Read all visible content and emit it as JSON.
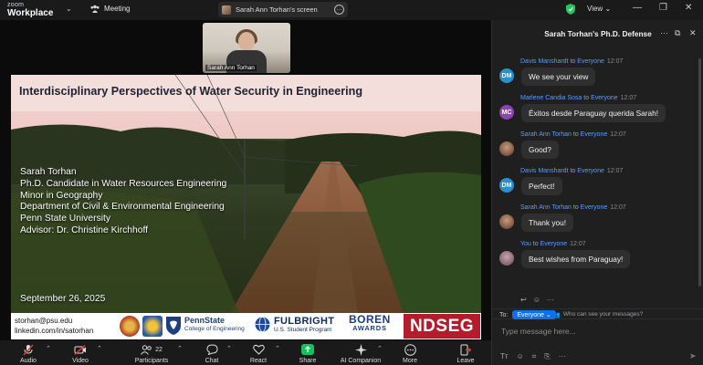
{
  "app": {
    "logo_top": "zoom",
    "logo_bottom": "Workplace",
    "meeting_label": "Meeting",
    "screen_share_label": "Sarah Ann Torhan's screen",
    "view_label": "View"
  },
  "video": {
    "name": "Sarah Ann Torhan"
  },
  "slide": {
    "title": "Interdisciplinary Perspectives of Water Security in Engineering",
    "lines": [
      "Sarah Torhan",
      "Ph.D. Candidate in Water Resources Engineering",
      "Minor in Geography",
      "Department of Civil & Environmental Engineering",
      "Penn State University",
      "Advisor: Dr. Christine Kirchhoff"
    ],
    "date": "September 26, 2025",
    "email": "storhan@psu.edu",
    "linkedin": "linkedin.com/in/satorhan",
    "psu_name": "PennState",
    "psu_college": "College of Engineering",
    "fulbright": "FULBRIGHT",
    "fulbright_sub": "U.S. Student Program",
    "boren": "BOREN",
    "boren_sub": "AWARDS",
    "ndseg": "NDSEG"
  },
  "toolbar": {
    "audio": "Audio",
    "video": "Video",
    "participants": "Participants",
    "participants_count": "22",
    "chat": "Chat",
    "react": "React",
    "share": "Share",
    "ai": "AI Companion",
    "more": "More",
    "leave": "Leave"
  },
  "chat": {
    "title": "Sarah Torhan's Ph.D. Defense",
    "to_word": "to",
    "everyone": "Everyone",
    "messages": [
      {
        "sender": "Davis Manshardt",
        "initials": "DM",
        "color": "#2d8fc9",
        "time": "12:07",
        "text": "We see your view"
      },
      {
        "sender": "Marlene Candia Sosa",
        "initials": "MC",
        "color": "#8e44ad",
        "time": "12:07",
        "text": "Éxitos desde Paraguay querida Sarah!"
      },
      {
        "sender": "Sarah Ann Torhan",
        "initials": "",
        "color": "#8a5a3c",
        "time": "12:07",
        "text": "Good?"
      },
      {
        "sender": "Davis Manshardt",
        "initials": "DM",
        "color": "#2d8fc9",
        "time": "12:07",
        "text": "Perfect!"
      },
      {
        "sender": "Sarah Ann Torhan",
        "initials": "",
        "color": "#8a5a3c",
        "time": "12:07",
        "text": "Thank you!"
      },
      {
        "sender": "You",
        "initials": "",
        "color": "#9d7c86",
        "time": "12:07",
        "text": "Best wishes from Paraguay!"
      }
    ],
    "privacy": "Who can see your messages?",
    "to_label": "To:",
    "to_chip": "Everyone",
    "placeholder": "Type message here..."
  }
}
